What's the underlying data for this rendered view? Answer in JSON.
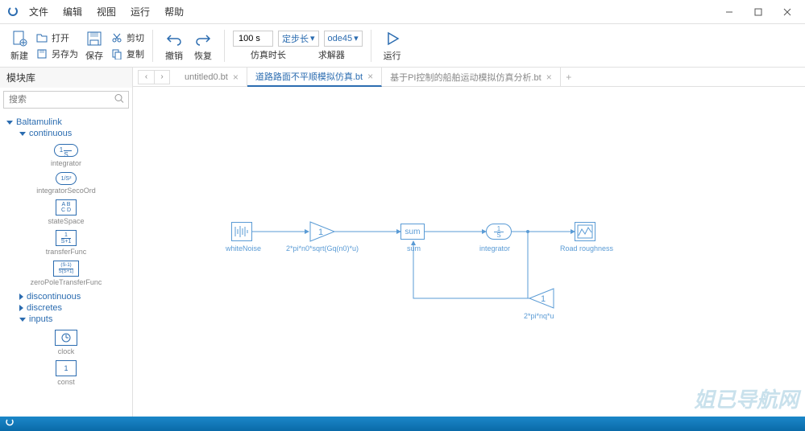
{
  "menu": {
    "items": [
      "文件",
      "编辑",
      "视图",
      "运行",
      "帮助"
    ]
  },
  "toolbar": {
    "new": "新建",
    "open": "打开",
    "saveAs": "另存为",
    "save": "保存",
    "cut": "剪切",
    "copy": "复制",
    "undo": "撤销",
    "redo": "恢复",
    "sim_time_value": "100 s",
    "sim_time_label": "仿真时长",
    "step_mode": "定步长",
    "solver": "ode45",
    "solver_label": "求解器",
    "run": "运行"
  },
  "sidebar": {
    "title": "模块库",
    "search_placeholder": "搜索",
    "root": "Baltamulink",
    "categories": {
      "continuous": "continuous",
      "discontinuous": "discontinuous",
      "discretes": "discretes",
      "inputs": "inputs"
    },
    "blocks": {
      "integrator": {
        "symbol": "1/S",
        "label": "integrator"
      },
      "integratorSecondOrd": {
        "symbol": "1/S²",
        "label": "integratorSecoOrd"
      },
      "stateSpace": {
        "symbol": "A B\nC D",
        "label": "stateSpace"
      },
      "transferFunc": {
        "symbol": "1/S+1",
        "label": "transferFunc"
      },
      "zeroPoleTransferFunc": {
        "symbol": "(S-1)/S(S+1)",
        "label": "zeroPoleTransferFunc"
      },
      "clock": {
        "label": "clock"
      },
      "const": {
        "symbol": "1",
        "label": "const"
      }
    }
  },
  "tabs": {
    "items": [
      {
        "label": "untitled0.bt",
        "active": false
      },
      {
        "label": "道路路面不平顺模拟仿真.bt",
        "active": true
      },
      {
        "label": "基于PI控制的船舶运动模拟仿真分析.bt",
        "active": false
      }
    ]
  },
  "canvas": {
    "nodes": {
      "whiteNoise": {
        "label": "whiteNoise"
      },
      "gain1": {
        "label": "2*pi*n0*sqrt(Gq(n0)*u)",
        "value": "1"
      },
      "sum": {
        "label": "sum",
        "text": "sum"
      },
      "integrator": {
        "label": "integrator",
        "symbol": "1/S"
      },
      "scope": {
        "label": "Road roughness"
      },
      "gain2": {
        "label": "2*pi*nq*u",
        "value": "1"
      }
    }
  },
  "watermark": "姐已导航网"
}
